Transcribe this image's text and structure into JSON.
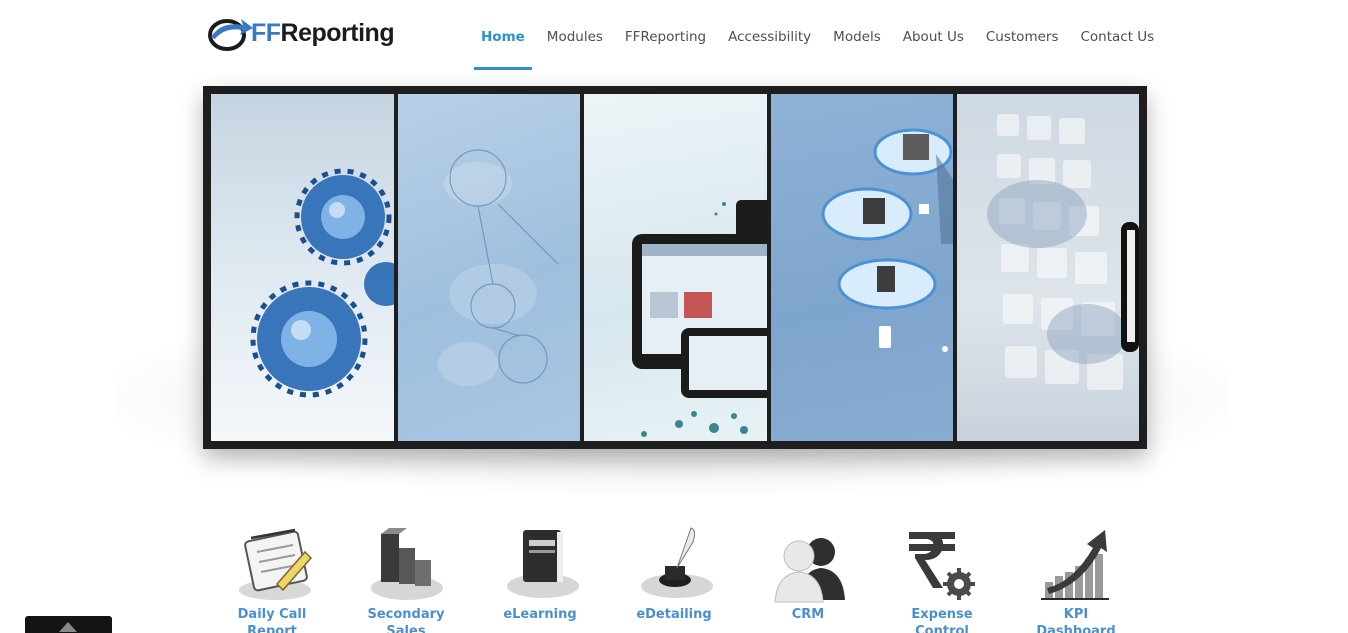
{
  "brand": {
    "logo_text_accent": "FF",
    "logo_text_rest": "Reporting",
    "accent_color": "#2e8fd0",
    "logo_color": "#3b78c2"
  },
  "nav": {
    "items": [
      {
        "label": "Home",
        "active": true
      },
      {
        "label": "Modules"
      },
      {
        "label": "FFReporting"
      },
      {
        "label": "Accessibility"
      },
      {
        "label": "Models"
      },
      {
        "label": "About Us"
      },
      {
        "label": "Customers"
      },
      {
        "label": "Contact Us"
      }
    ]
  },
  "slider": {
    "panels": [
      {
        "icon": "gear-globe-icon"
      },
      {
        "icon": "world-map-icon"
      },
      {
        "icon": "tablet-phone-icon"
      },
      {
        "icon": "cloud-devices-icon"
      },
      {
        "icon": "map-tiles-icon"
      }
    ]
  },
  "modules": [
    {
      "label": "Daily Call Report",
      "icon": "notepad-icon"
    },
    {
      "label": "Secondary Sales",
      "icon": "bar-blocks-icon"
    },
    {
      "label": "eLearning",
      "icon": "book-icon"
    },
    {
      "label": "eDetailing",
      "icon": "quill-ink-icon"
    },
    {
      "label": "CRM",
      "icon": "people-icon"
    },
    {
      "label": "Expense Control",
      "icon": "rupee-gear-icon"
    },
    {
      "label": "KPI Dashboard",
      "icon": "growth-chart-icon"
    }
  ]
}
